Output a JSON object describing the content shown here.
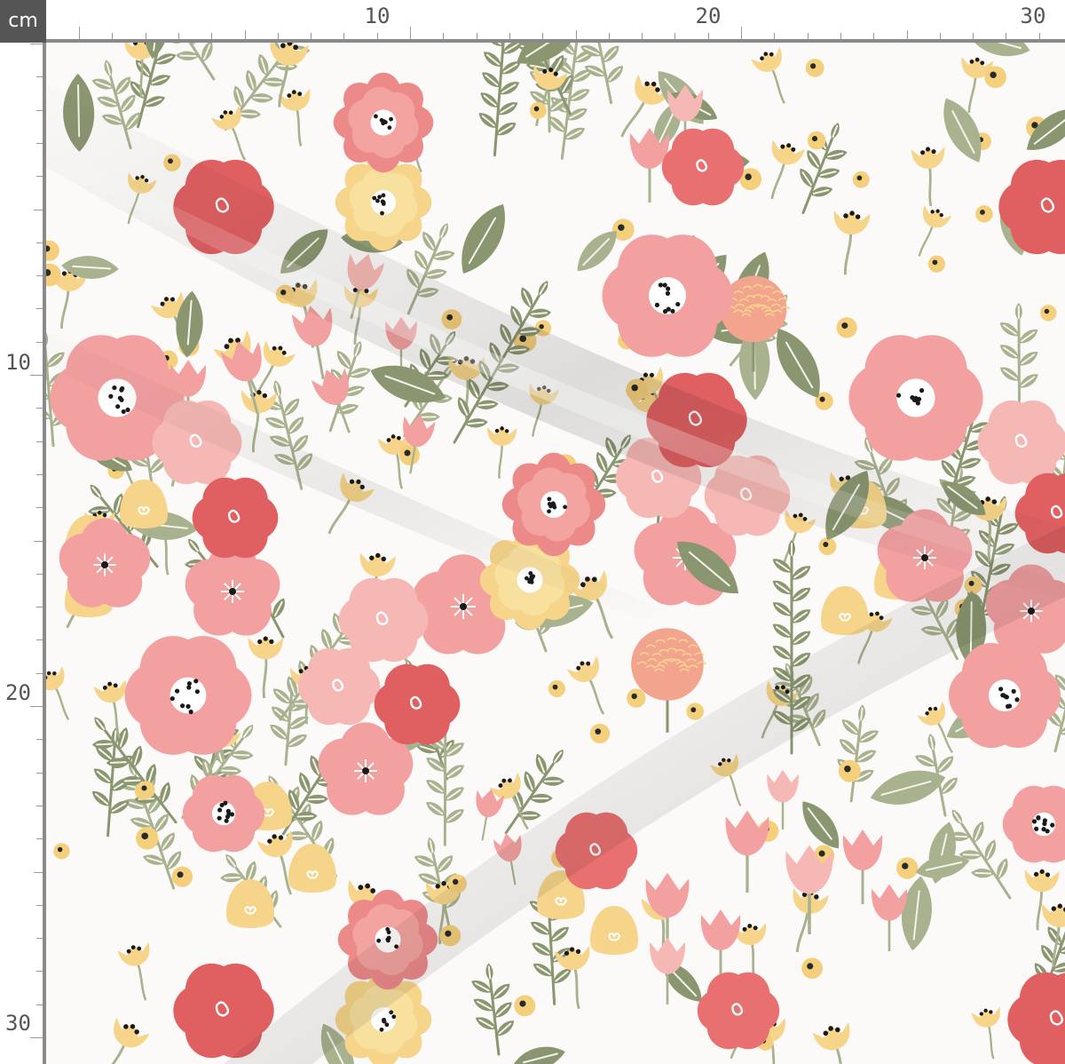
{
  "ruler": {
    "unit": "cm",
    "top_labels": [
      "10",
      "20",
      "30"
    ],
    "left_labels": [
      "10",
      "20",
      "30"
    ]
  },
  "palette": {
    "background": "#fbfaf8",
    "pink": "#f2a0a0",
    "light_pink": "#f6b8b4",
    "red": "#e06062",
    "yellow": "#f6d58a",
    "sage": "#8a9670",
    "light_sage": "#a9b28f",
    "ruler_gray": "#555555"
  },
  "icons": [
    "unit-badge",
    "ruler-ticks",
    "floral-print"
  ]
}
